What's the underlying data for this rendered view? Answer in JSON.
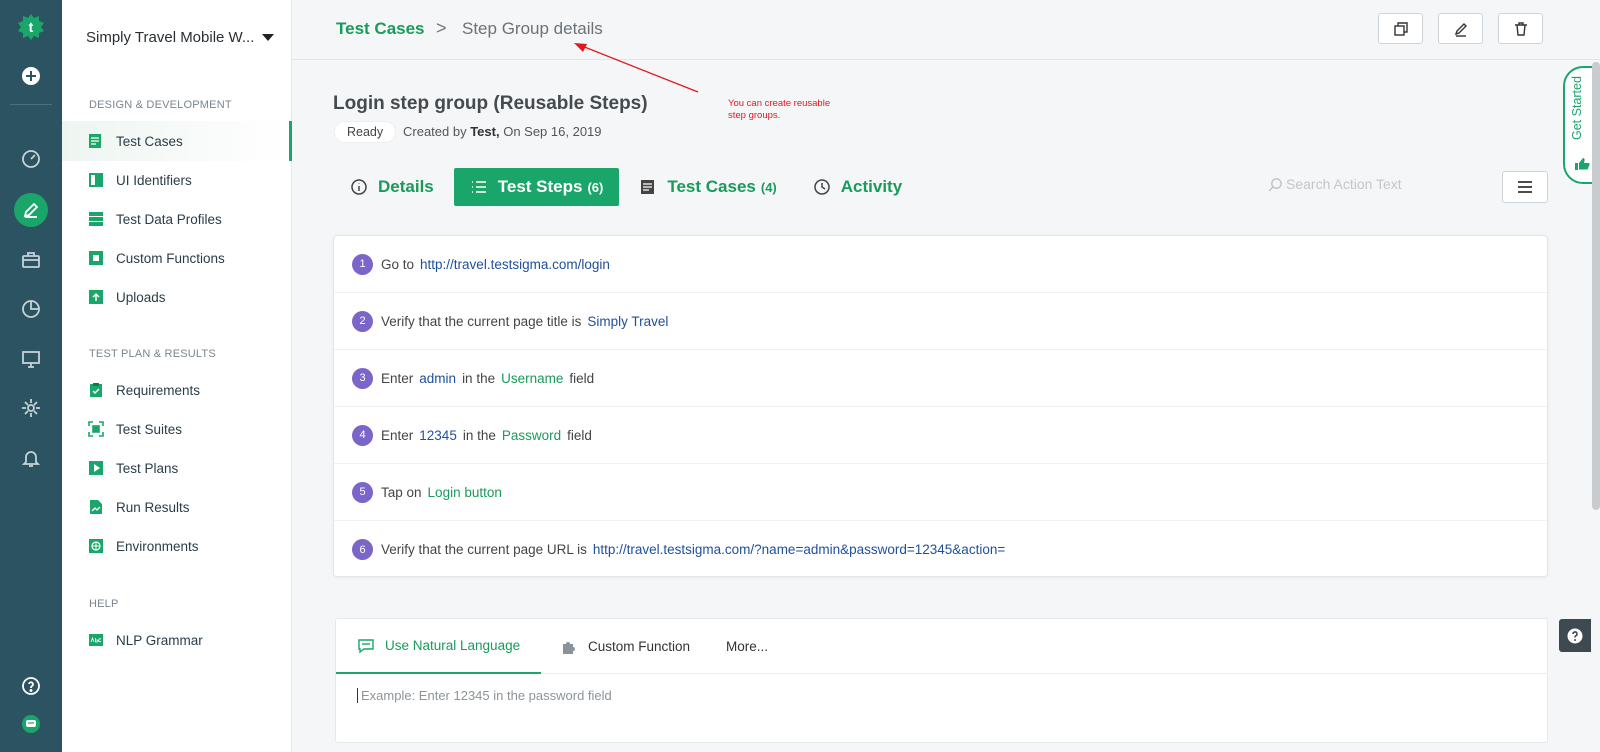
{
  "colors": {
    "accent": "#1aa66a",
    "rail": "#2b5361",
    "step_number": "#7b65c9",
    "annotation": "#e0191e",
    "link_blue": "#1f4f9c"
  },
  "rail": {
    "icons": [
      "logo-icon",
      "add-icon",
      "dashboard-icon",
      "edit-icon",
      "briefcase-icon",
      "pie-chart-icon",
      "monitor-icon",
      "settings-icon",
      "bell-icon",
      "help-icon",
      "chat-icon"
    ]
  },
  "sidebar": {
    "project": "Simply Travel Mobile W...",
    "sections": [
      {
        "title": "DESIGN & DEVELOPMENT",
        "items": [
          {
            "label": "Test Cases",
            "icon": "test-cases-icon"
          },
          {
            "label": "UI Identifiers",
            "icon": "ui-identifiers-icon"
          },
          {
            "label": "Test Data Profiles",
            "icon": "data-profiles-icon"
          },
          {
            "label": "Custom Functions",
            "icon": "puzzle-icon"
          },
          {
            "label": "Uploads",
            "icon": "upload-icon"
          }
        ]
      },
      {
        "title": "TEST PLAN & RESULTS",
        "items": [
          {
            "label": "Requirements",
            "icon": "clipboard-icon"
          },
          {
            "label": "Test Suites",
            "icon": "suites-icon"
          },
          {
            "label": "Test Plans",
            "icon": "play-icon"
          },
          {
            "label": "Run Results",
            "icon": "results-icon"
          },
          {
            "label": "Environments",
            "icon": "globe-icon"
          }
        ]
      },
      {
        "title": "HELP",
        "items": [
          {
            "label": "NLP Grammar",
            "icon": "abc-icon"
          }
        ]
      }
    ]
  },
  "breadcrumb": {
    "root": "Test Cases",
    "separator": ">",
    "current": "Step Group details"
  },
  "header": {
    "title": "Login step group (Reusable Steps)",
    "status": "Ready",
    "created_prefix": "Created by ",
    "created_by": "Test,",
    "created_date": " On Sep 16, 2019"
  },
  "annotation": {
    "line1": "You can create reusable",
    "line2": "step groups."
  },
  "tabs": [
    {
      "label": "Details",
      "count": ""
    },
    {
      "label": "Test Steps",
      "count": "(6)"
    },
    {
      "label": "Test Cases",
      "count": "(4)"
    },
    {
      "label": "Activity",
      "count": ""
    }
  ],
  "search": {
    "placeholder": "Search Action Text"
  },
  "steps": [
    {
      "num": "1",
      "parts": [
        "Go to",
        "http://travel.testsigma.com/login"
      ]
    },
    {
      "num": "2",
      "parts": [
        "Verify that the current page title is",
        "Simply Travel"
      ]
    },
    {
      "num": "3",
      "parts": [
        "Enter",
        "admin",
        "in the",
        "Username",
        "field"
      ]
    },
    {
      "num": "4",
      "parts": [
        "Enter",
        "12345",
        "in the",
        "Password",
        "field"
      ]
    },
    {
      "num": "5",
      "parts": [
        "Tap on",
        "Login button"
      ]
    },
    {
      "num": "6",
      "parts": [
        "Verify that the current page URL is",
        "http://travel.testsigma.com/?name=admin&password=12345&action="
      ]
    }
  ],
  "editor": {
    "tabs": [
      "Use Natural Language",
      "Custom Function",
      "More..."
    ],
    "placeholder": "Example: Enter 12345 in the password field"
  },
  "get_started": "Get Started"
}
